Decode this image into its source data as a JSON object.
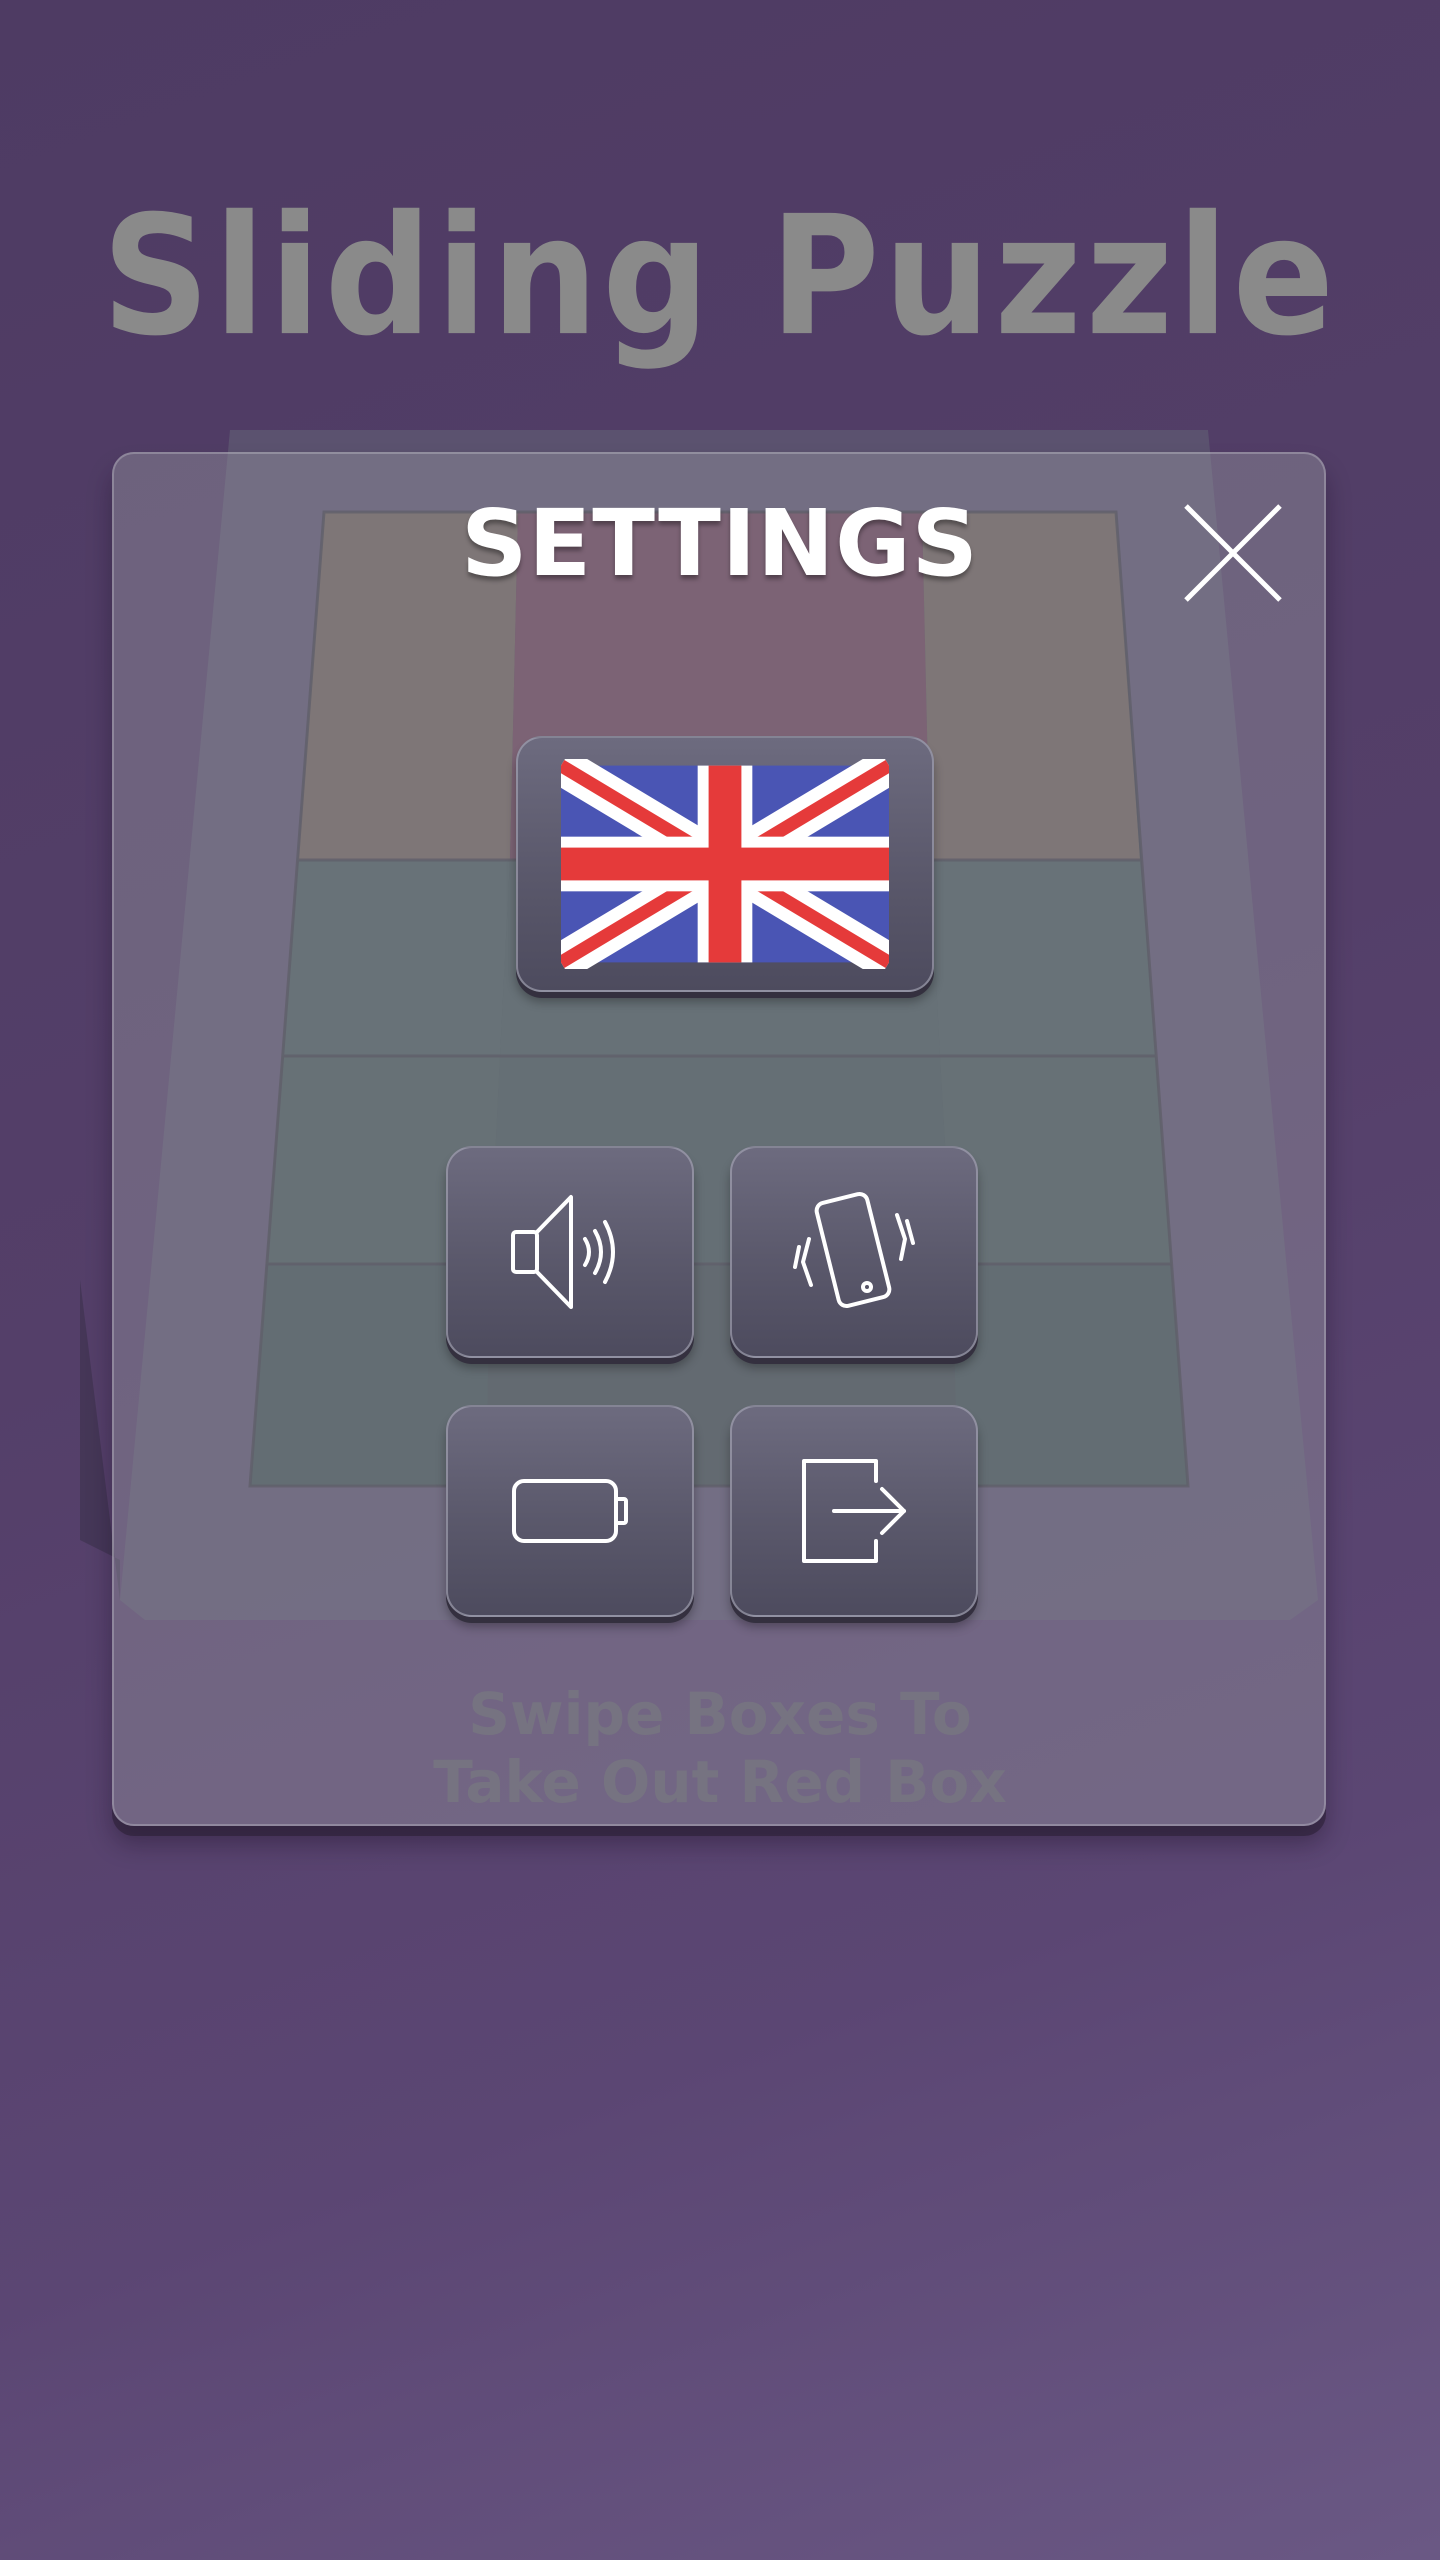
{
  "game": {
    "title": "Sliding Puzzle",
    "hint_line1": "Swipe Boxes To",
    "hint_line2": "Take Out Red Box"
  },
  "settings": {
    "title": "SETTINGS",
    "close_icon": "close-icon",
    "language_icon": "uk-flag-icon",
    "buttons": [
      {
        "name": "sound",
        "icon": "speaker-icon"
      },
      {
        "name": "vibration",
        "icon": "vibrate-phone-icon"
      },
      {
        "name": "power-saving",
        "icon": "battery-icon"
      },
      {
        "name": "exit",
        "icon": "exit-icon"
      }
    ]
  },
  "colors": {
    "background": "#543f69",
    "red_box": "#8a3d4e",
    "flag_blue": "#4a55b4",
    "flag_red": "#e53a3a"
  }
}
